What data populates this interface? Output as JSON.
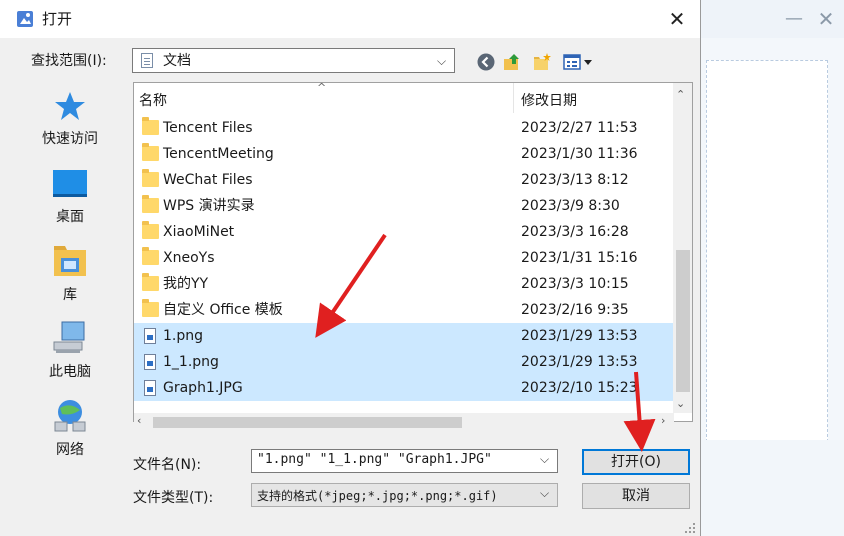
{
  "dialog": {
    "title": "打开",
    "close_glyph": "✕",
    "look_in_label": "查找范围(I):",
    "look_in_value": "文档",
    "toolbar": [
      "back-icon",
      "up-folder-icon",
      "new-folder-icon",
      "views-menu-icon"
    ]
  },
  "places": [
    {
      "label": "快速访问",
      "icon": "star-icon"
    },
    {
      "label": "桌面",
      "icon": "desktop-icon"
    },
    {
      "label": "库",
      "icon": "library-icon"
    },
    {
      "label": "此电脑",
      "icon": "computer-icon"
    },
    {
      "label": "网络",
      "icon": "network-icon"
    }
  ],
  "columns": {
    "name": "名称",
    "date": "修改日期",
    "sort_glyph": "^"
  },
  "files": [
    {
      "name": "Tencent Files",
      "date": "2023/2/27 11:53",
      "type": "folder",
      "selected": false
    },
    {
      "name": "TencentMeeting",
      "date": "2023/1/30 11:36",
      "type": "folder",
      "selected": false
    },
    {
      "name": "WeChat Files",
      "date": "2023/3/13 8:12",
      "type": "folder",
      "selected": false
    },
    {
      "name": "WPS 演讲实录",
      "date": "2023/3/9 8:30",
      "type": "folder",
      "selected": false
    },
    {
      "name": "XiaoMiNet",
      "date": "2023/3/3 16:28",
      "type": "folder",
      "selected": false
    },
    {
      "name": "XneoYs",
      "date": "2023/1/31 15:16",
      "type": "folder",
      "selected": false
    },
    {
      "name": "我的YY",
      "date": "2023/3/3 10:15",
      "type": "folder",
      "selected": false
    },
    {
      "name": "自定义 Office 模板",
      "date": "2023/2/16 9:35",
      "type": "folder",
      "selected": false
    },
    {
      "name": "1.png",
      "date": "2023/1/29 13:53",
      "type": "image",
      "selected": true
    },
    {
      "name": "1_1.png",
      "date": "2023/1/29 13:53",
      "type": "image",
      "selected": true
    },
    {
      "name": "Graph1.JPG",
      "date": "2023/2/10 15:23",
      "type": "image",
      "selected": true
    }
  ],
  "bottom": {
    "filename_label": "文件名(N):",
    "filename_value": "\"1.png\" \"1_1.png\" \"Graph1.JPG\"",
    "filetype_label": "文件类型(T):",
    "filetype_value": "支持的格式(*jpeg;*.jpg;*.png;*.gif)",
    "open_label": "打开(O)",
    "cancel_label": "取消"
  },
  "background_window": {
    "minimize_glyph": "—",
    "close_glyph": "✕"
  },
  "colors": {
    "selection": "#cce8ff",
    "focus_border": "#0078d7",
    "annotation_arrow": "#e02020"
  }
}
